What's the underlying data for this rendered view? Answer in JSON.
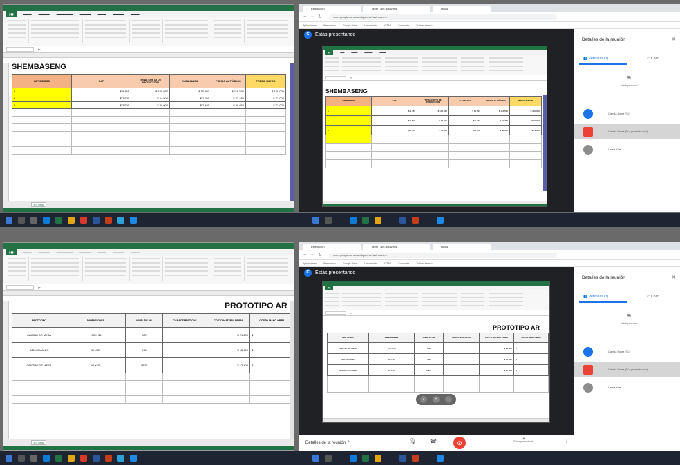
{
  "screens": {
    "top": {
      "sheet_title": "SHEMBASENG",
      "headers": [
        "IMPERDIDOS",
        "C.I.F",
        "TOTAL COSTO DE PRODUCCIÓN",
        "% GANANCIA",
        "PRECIO AL PÚBLICO",
        "PRECIO MAYOR"
      ],
      "rows": [
        [
          "$",
          "$ 5.455",
          "$ 105.937",
          "$ 10.593",
          "$ 116.530",
          "$ 120.000"
        ],
        [
          "$",
          "$ 2.500",
          "$ 64.500",
          "$ 1.250",
          "$ 72.450",
          "$ 72.000"
        ],
        [
          "$",
          "$ 2.500",
          "$ 48.000",
          "$ 2.480",
          "$ 58.650",
          "$ 72.000"
        ]
      ],
      "sheet_tab": "ESTIMA"
    },
    "bottom": {
      "sheet_title": "PROTOTIPO AR",
      "headers": [
        "PROTOTIPO",
        "DIMENSIONES",
        "NIVEL DE AR",
        "CARACTERISTICAS",
        "COSTO MATERIA PRIMA",
        "COSTO MANO OBRA"
      ],
      "rows": [
        [
          "CAMINO DE MESA",
          "130 X 35",
          "AIR",
          "",
          "$ 21.600",
          "$"
        ],
        [
          "INDIVIDUALES",
          "40 X 35",
          "IND",
          "",
          "$ 15.400",
          "$"
        ],
        [
          "CENTRO DE MESA",
          "40 X 45",
          "RES",
          "",
          "$ 17.400",
          "$"
        ]
      ],
      "sheet_tab": "ESTIMA"
    }
  },
  "meet": {
    "presenting_label": "Estás presentando",
    "presenter_initial": "C",
    "panel_title": "Detalles de la reunión",
    "tab_people": "Personas (3)",
    "tab_chat": "Chat",
    "add_people": "Añadir personas",
    "participants": [
      "Camila Ibáez (Tú)",
      "Camila Ibáez (Tú, presentación)",
      "Laura Kim"
    ],
    "controls_details": "Detalles de la reunión",
    "present_now": "Estás presentando"
  },
  "browser": {
    "tabs": [
      "Estimación",
      "Meet - rwz-dqpw-hts",
      "Hojas"
    ],
    "url": "meet.google.com/rwz-dqpw-hts?authuser=1",
    "bookmarks": [
      "Aplicaciones",
      "Bienvenido",
      "Google Drive",
      "Universidad",
      "CITAS",
      "Compartir",
      "Todo el estado"
    ]
  },
  "colors": {
    "excel_green": "#217346",
    "header_orange": "#f4b183",
    "cell_yellow": "#ffff00",
    "meet_blue": "#1a73e8",
    "hangup_red": "#ea4335",
    "taskbar": "#1f2433"
  }
}
